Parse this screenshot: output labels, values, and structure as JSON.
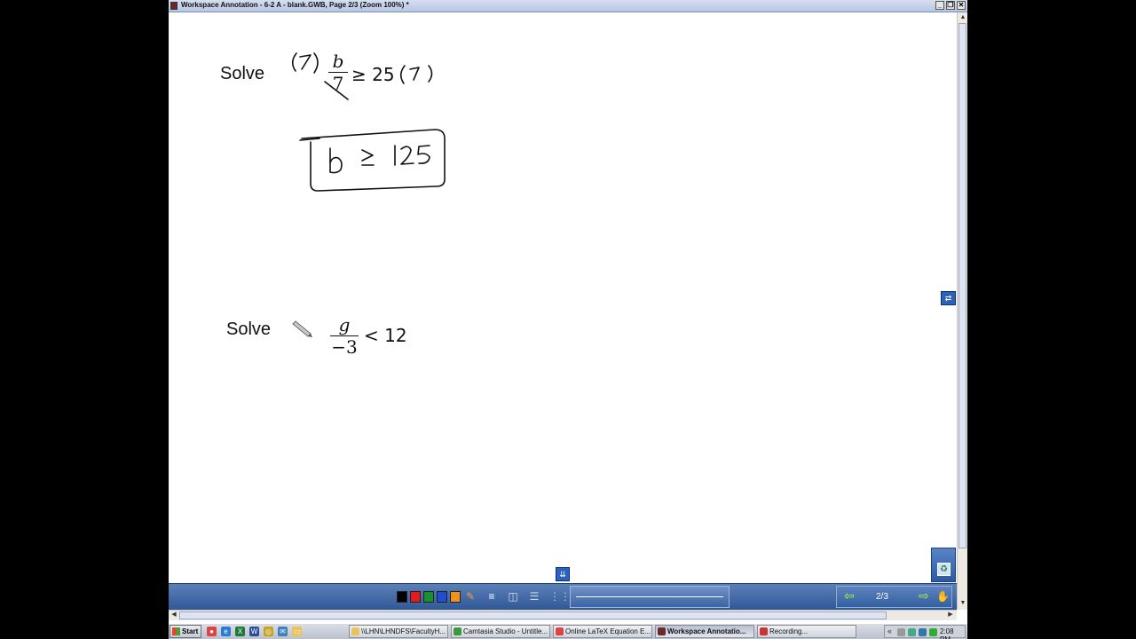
{
  "window": {
    "title": "Workspace Annotation - 6-2 A - blank.GWB, Page 2/3 (Zoom 100%) *",
    "buttons": {
      "minimize": "_",
      "restore": "❐",
      "close": "✕"
    }
  },
  "canvas": {
    "problem1": {
      "label": "Solve",
      "numerator": "b",
      "denominator": "7",
      "relation": "≥ 25",
      "handwritten": [
        "(7)",
        "(7)",
        "b ≥ 125"
      ]
    },
    "problem2": {
      "label": "Solve",
      "numerator": "g",
      "denominator": "−3",
      "relation": "< 12"
    }
  },
  "toolbar": {
    "colors": [
      "#000000",
      "#e8191c",
      "#1b8f2c",
      "#1c4fd4",
      "#f0901e"
    ],
    "icons": [
      "highlighter-icon",
      "line-width-icon",
      "eraser-icon",
      "lines-icon",
      "grid-icon"
    ],
    "page_indicator": "2/3",
    "prev_icon": "arrow-left-icon",
    "next_icon": "arrow-right-icon"
  },
  "taskbar": {
    "start_label": "Start",
    "quick_launch": [
      "chrome-icon",
      "ie-icon",
      "excel-icon",
      "word-icon",
      "app-icon",
      "outlook-icon",
      "folder-icon"
    ],
    "tasks": [
      {
        "label": "\\\\LHN\\LHNDFS\\FacultyH...",
        "active": false
      },
      {
        "label": "Camtasia Studio - Untitle...",
        "active": false
      },
      {
        "label": "Online LaTeX Equation E...",
        "active": false
      },
      {
        "label": "Workspace Annotatio...",
        "active": true
      },
      {
        "label": "Recording...",
        "active": false
      }
    ],
    "clock": "2:08 PM"
  }
}
